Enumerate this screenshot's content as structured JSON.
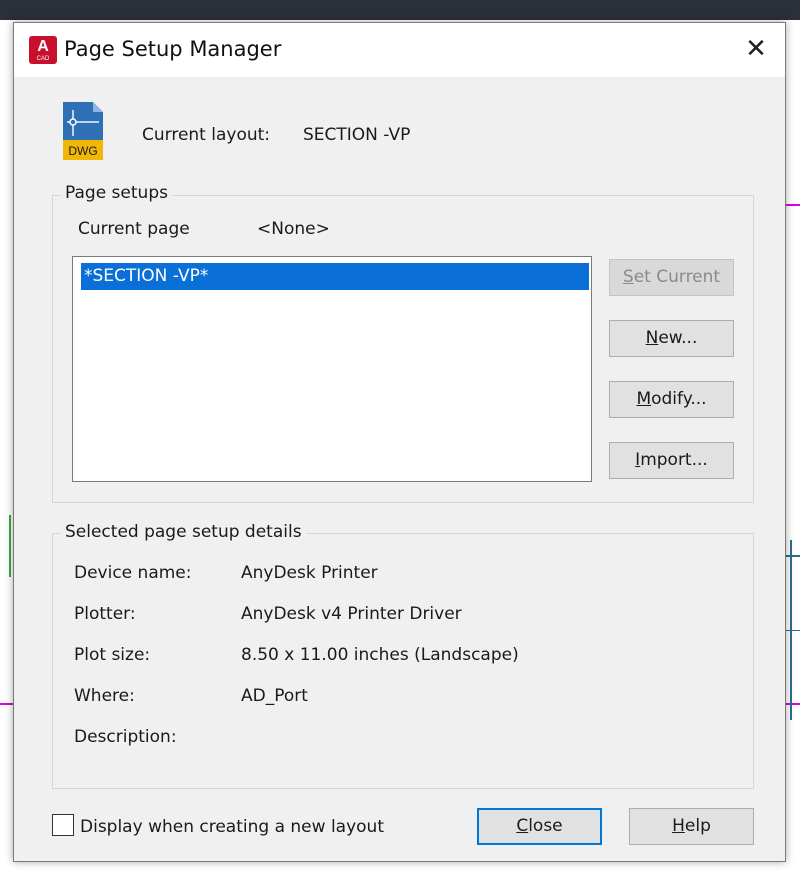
{
  "dialog": {
    "title": "Page Setup Manager",
    "app_icon_letter": "A",
    "app_icon_sub": "CAD",
    "close_glyph": "✕"
  },
  "current_layout": {
    "label": "Current layout:",
    "value": "SECTION -VP",
    "icon_caption": "DWG"
  },
  "page_setups": {
    "group_title": "Page setups",
    "current_page_label": "Current page",
    "current_page_value": "<None>",
    "list_items": [
      {
        "label": "*SECTION -VP*",
        "selected": true
      }
    ],
    "buttons": {
      "set_current": {
        "first": "S",
        "rest": "et Current"
      },
      "new": {
        "first": "N",
        "rest": "ew..."
      },
      "modify": {
        "first": "M",
        "rest": "odify..."
      },
      "import": {
        "first": "I",
        "rest": "mport..."
      }
    }
  },
  "details": {
    "group_title": "Selected page setup details",
    "rows": [
      {
        "label": "Device name:",
        "value": "AnyDesk Printer"
      },
      {
        "label": "Plotter:",
        "value": "AnyDesk v4 Printer Driver"
      },
      {
        "label": "Plot size:",
        "value": "8.50 x 11.00 inches (Landscape)"
      },
      {
        "label": "Where:",
        "value": "AD_Port"
      },
      {
        "label": "Description:",
        "value": ""
      }
    ]
  },
  "footer": {
    "checkbox_label": "Display when creating a new layout",
    "checkbox_checked": false,
    "close_button": {
      "first": "C",
      "rest": "lose"
    },
    "help_button": {
      "first": "H",
      "rest": "elp"
    }
  },
  "colors": {
    "selection": "#0a6fd6",
    "app_icon": "#c8102e",
    "default_button_border": "#0078d7",
    "dwg_blue": "#2f6fb5",
    "dwg_yellow": "#f2b705"
  },
  "icons": [
    "autocad-app-icon",
    "close-icon",
    "dwg-file-icon",
    "checkbox"
  ]
}
